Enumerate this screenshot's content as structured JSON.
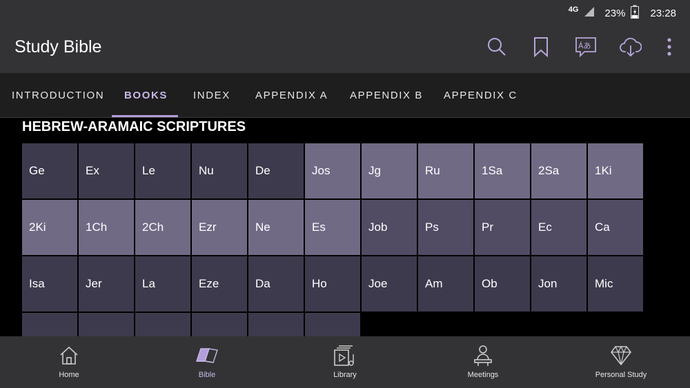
{
  "status_bar": {
    "network": "4G",
    "battery": "23%",
    "time": "23:28"
  },
  "app_bar": {
    "title": "Study Bible",
    "actions": [
      "search-icon",
      "bookmark-icon",
      "language-icon",
      "download-icon",
      "more-vert-icon"
    ]
  },
  "tabs": [
    {
      "label": "INTRODUCTION",
      "active": false
    },
    {
      "label": "BOOKS",
      "active": true
    },
    {
      "label": "INDEX",
      "active": false
    },
    {
      "label": "APPENDIX A",
      "active": false
    },
    {
      "label": "APPENDIX B",
      "active": false
    },
    {
      "label": "APPENDIX C",
      "active": false
    }
  ],
  "section_title": "HEBREW-ARAMAIC SCRIPTURES",
  "colors": {
    "dark": "#3e3a4d",
    "mid": "#514b63",
    "light": "#716a85",
    "accent": "#b39ddb"
  },
  "books": [
    {
      "label": "Ge",
      "shade": "dark"
    },
    {
      "label": "Ex",
      "shade": "dark"
    },
    {
      "label": "Le",
      "shade": "dark"
    },
    {
      "label": "Nu",
      "shade": "dark"
    },
    {
      "label": "De",
      "shade": "dark"
    },
    {
      "label": "Jos",
      "shade": "light"
    },
    {
      "label": "Jg",
      "shade": "light"
    },
    {
      "label": "Ru",
      "shade": "light"
    },
    {
      "label": "1Sa",
      "shade": "light"
    },
    {
      "label": "2Sa",
      "shade": "light"
    },
    {
      "label": "1Ki",
      "shade": "light"
    },
    {
      "label": "2Ki",
      "shade": "light"
    },
    {
      "label": "1Ch",
      "shade": "light"
    },
    {
      "label": "2Ch",
      "shade": "light"
    },
    {
      "label": "Ezr",
      "shade": "light"
    },
    {
      "label": "Ne",
      "shade": "light"
    },
    {
      "label": "Es",
      "shade": "light"
    },
    {
      "label": "Job",
      "shade": "mid"
    },
    {
      "label": "Ps",
      "shade": "mid"
    },
    {
      "label": "Pr",
      "shade": "mid"
    },
    {
      "label": "Ec",
      "shade": "mid"
    },
    {
      "label": "Ca",
      "shade": "mid"
    },
    {
      "label": "Isa",
      "shade": "dark"
    },
    {
      "label": "Jer",
      "shade": "dark"
    },
    {
      "label": "La",
      "shade": "dark"
    },
    {
      "label": "Eze",
      "shade": "dark"
    },
    {
      "label": "Da",
      "shade": "dark"
    },
    {
      "label": "Ho",
      "shade": "dark"
    },
    {
      "label": "Joe",
      "shade": "dark"
    },
    {
      "label": "Am",
      "shade": "dark"
    },
    {
      "label": "Ob",
      "shade": "dark"
    },
    {
      "label": "Jon",
      "shade": "dark"
    },
    {
      "label": "Mic",
      "shade": "dark"
    },
    {
      "label": "",
      "shade": "dark"
    },
    {
      "label": "",
      "shade": "dark"
    },
    {
      "label": "",
      "shade": "dark"
    },
    {
      "label": "",
      "shade": "dark"
    },
    {
      "label": "",
      "shade": "dark"
    },
    {
      "label": "",
      "shade": "dark"
    }
  ],
  "bottom_nav": [
    {
      "label": "Home",
      "icon": "home-icon",
      "active": false
    },
    {
      "label": "Bible",
      "icon": "bible-icon",
      "active": true
    },
    {
      "label": "Library",
      "icon": "library-icon",
      "active": false
    },
    {
      "label": "Meetings",
      "icon": "meetings-icon",
      "active": false
    },
    {
      "label": "Personal Study",
      "icon": "diamond-icon",
      "active": false
    }
  ]
}
